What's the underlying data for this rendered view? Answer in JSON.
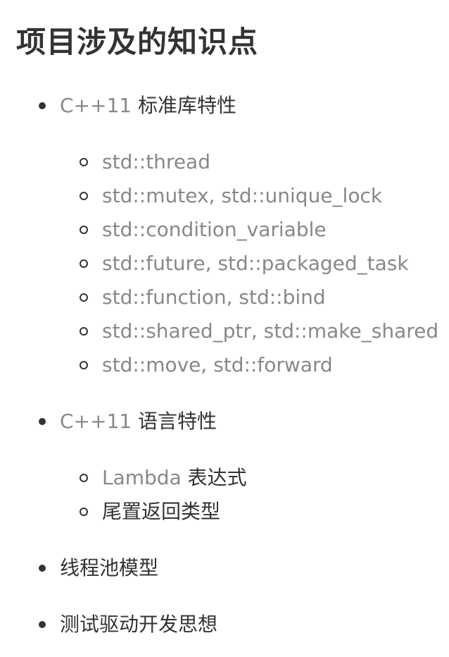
{
  "document": {
    "title": "项目涉及的知识点"
  },
  "list": {
    "stdlib": {
      "prefix": "C++11",
      "label": "标准库特性",
      "items": [
        "std::thread",
        "std::mutex, std::unique_lock",
        "std::condition_variable",
        "std::future, std::packaged_task",
        "std::function, std::bind",
        "std::shared_ptr, std::make_shared",
        "std::move, std::forward"
      ]
    },
    "language": {
      "prefix": "C++11",
      "label": "语言特性",
      "items": [
        {
          "prefix": "Lambda",
          "label": "表达式"
        },
        {
          "prefix": "",
          "label": "尾置返回类型"
        }
      ]
    },
    "threadpool": {
      "label": "线程池模型"
    },
    "tdd": {
      "label": "测试驱动开发思想"
    }
  }
}
